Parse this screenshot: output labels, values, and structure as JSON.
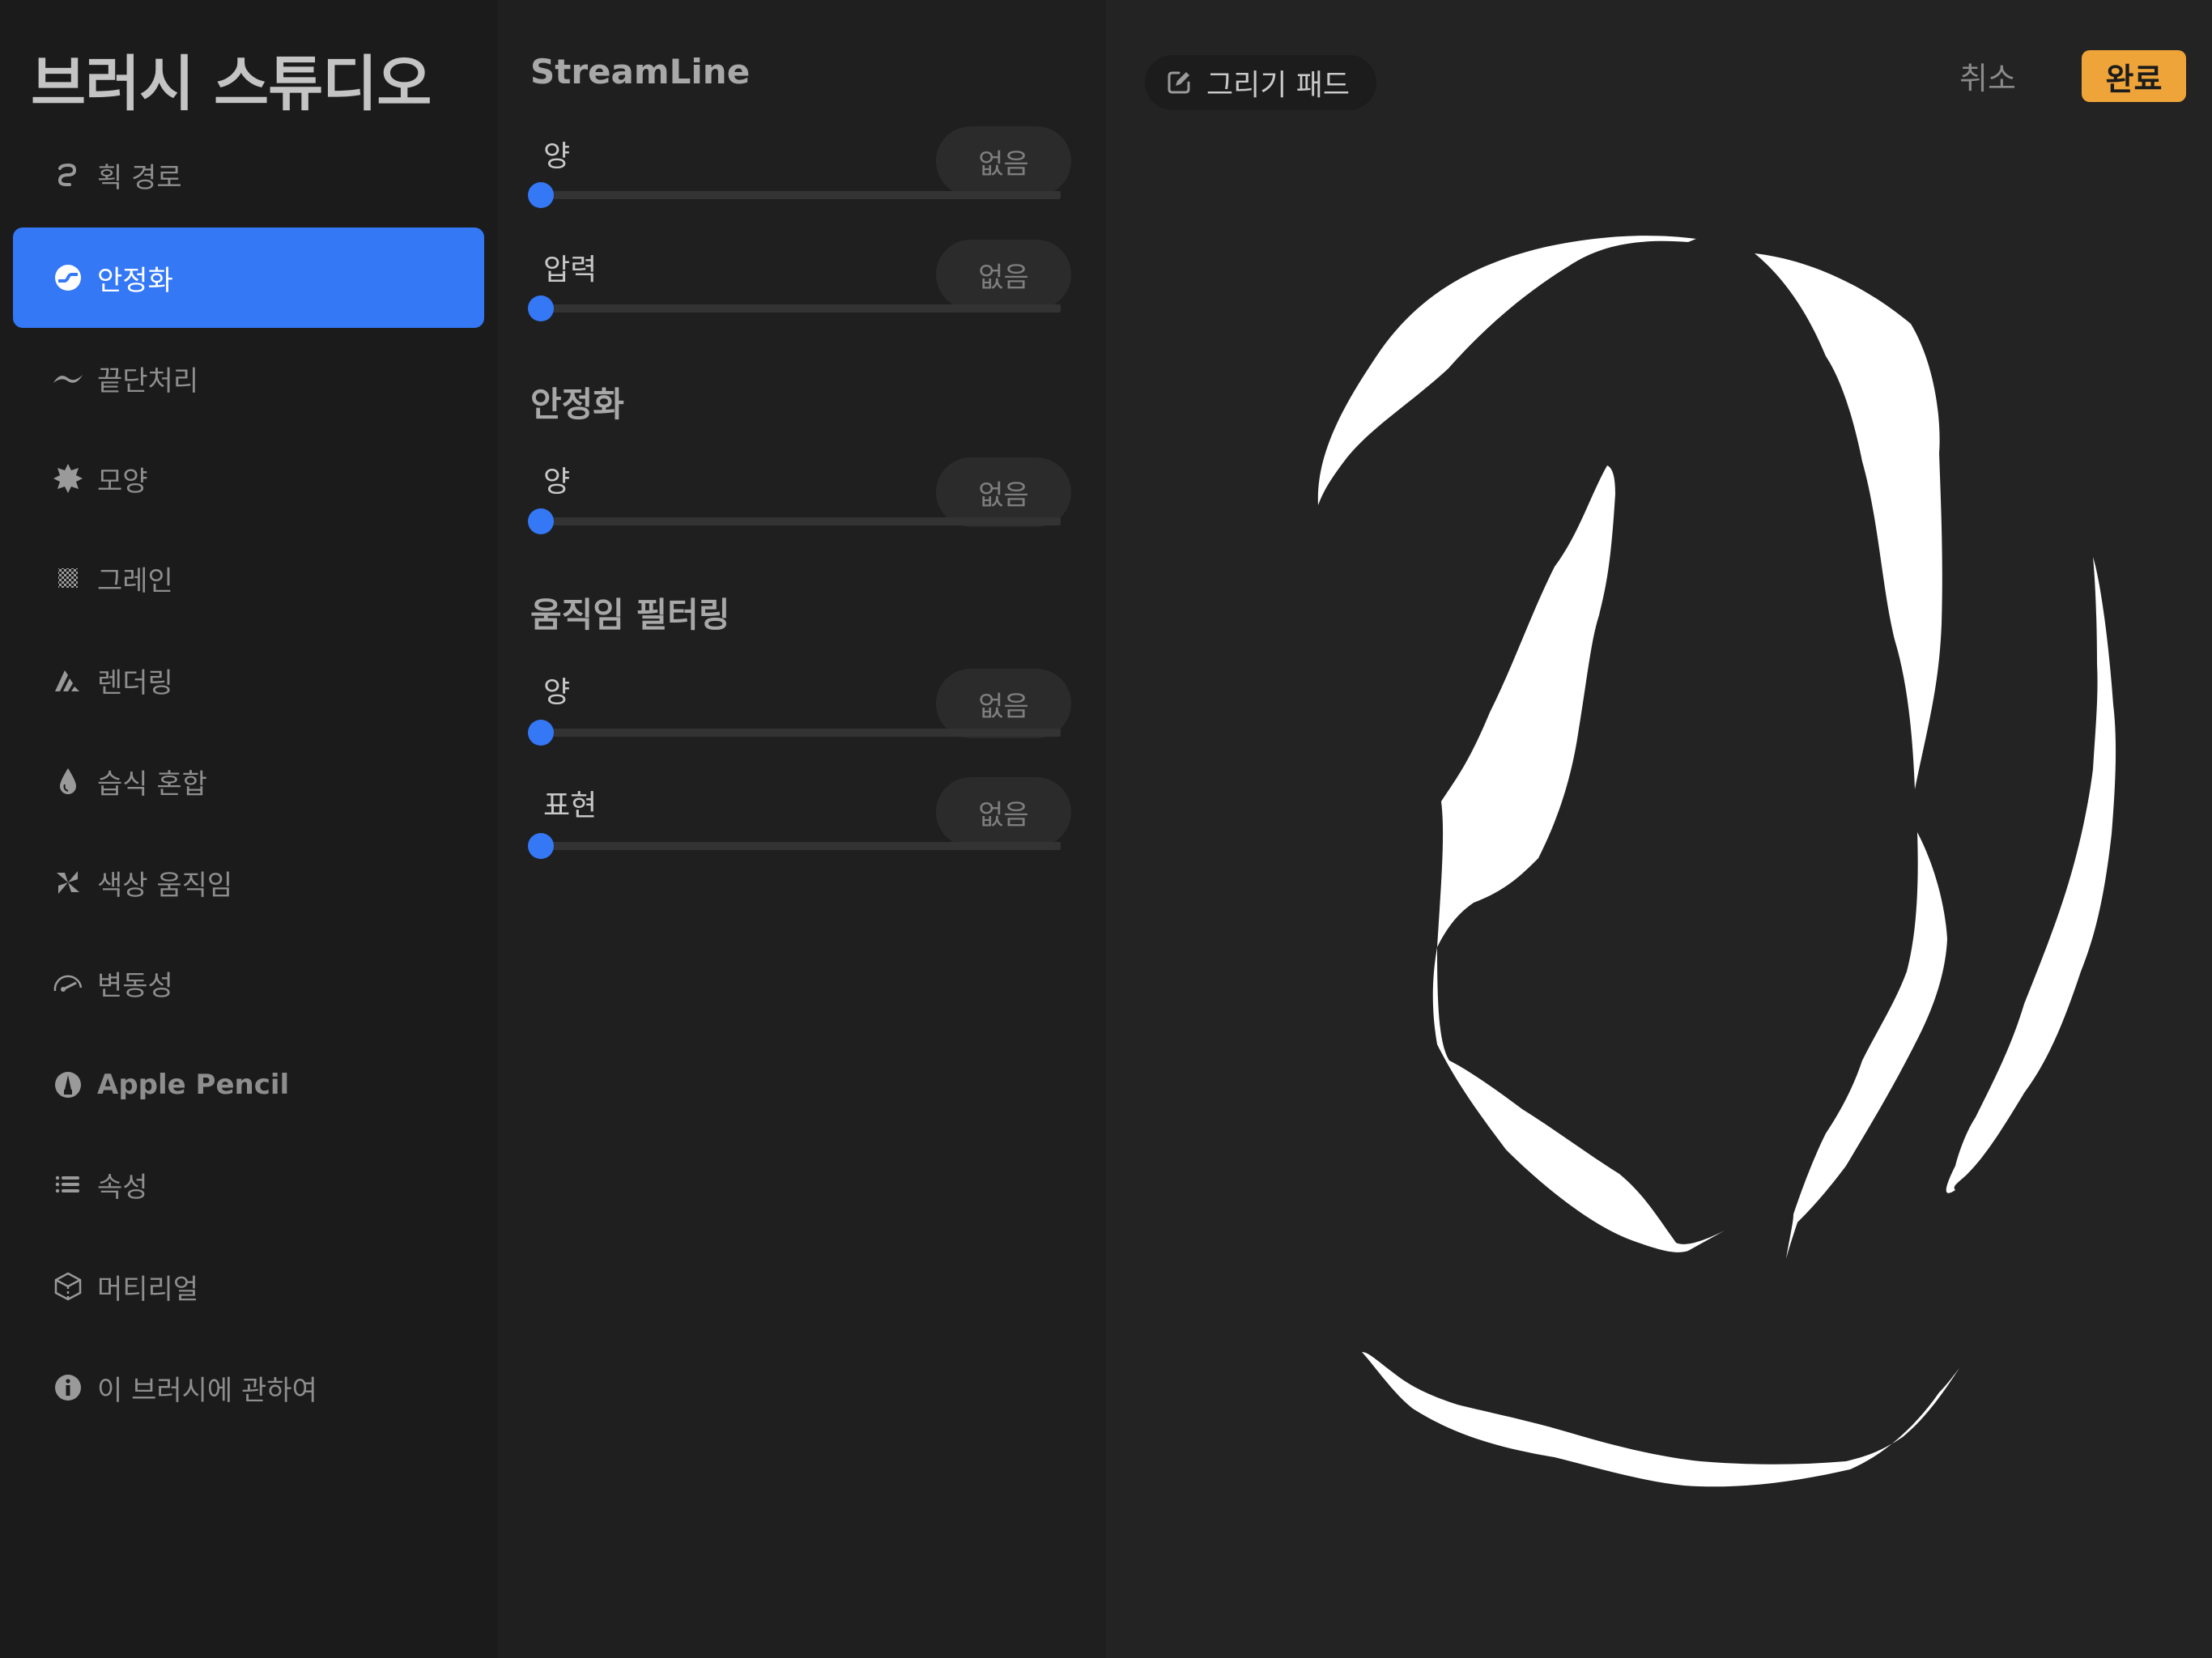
{
  "sidebar": {
    "title": "브러시 스튜디오",
    "items": [
      {
        "label": "획 경로",
        "icon": "stroke-path-icon",
        "active": false
      },
      {
        "label": "안정화",
        "icon": "stabilization-icon",
        "active": true
      },
      {
        "label": "끝단처리",
        "icon": "taper-icon",
        "active": false
      },
      {
        "label": "모양",
        "icon": "shape-icon",
        "active": false
      },
      {
        "label": "그레인",
        "icon": "grain-icon",
        "active": false
      },
      {
        "label": "렌더링",
        "icon": "rendering-icon",
        "active": false
      },
      {
        "label": "습식 혼합",
        "icon": "wet-mix-icon",
        "active": false
      },
      {
        "label": "색상 움직임",
        "icon": "color-dynamics-icon",
        "active": false
      },
      {
        "label": "변동성",
        "icon": "dynamics-gauge-icon",
        "active": false
      },
      {
        "label": "Apple Pencil",
        "icon": "apple-pencil-icon",
        "active": false
      },
      {
        "label": "속성",
        "icon": "properties-list-icon",
        "active": false
      },
      {
        "label": "머티리얼",
        "icon": "materials-cube-icon",
        "active": false
      },
      {
        "label": "이 브러시에 관하여",
        "icon": "info-icon",
        "active": false
      }
    ]
  },
  "settings": {
    "sections": [
      {
        "title": "StreamLine",
        "rows": [
          {
            "label": "양",
            "value": "없음",
            "slider_fraction": 0
          },
          {
            "label": "압력",
            "value": "없음",
            "slider_fraction": 0
          }
        ]
      },
      {
        "title": "안정화",
        "rows": [
          {
            "label": "양",
            "value": "없음",
            "slider_fraction": 0
          }
        ]
      },
      {
        "title": "움직임 필터링",
        "rows": [
          {
            "label": "양",
            "value": "없음",
            "slider_fraction": 0
          },
          {
            "label": "표현",
            "value": "없음",
            "slider_fraction": 0
          }
        ]
      }
    ]
  },
  "drawing_pad": {
    "pad_button_label": "그리기 패드",
    "cancel_label": "취소",
    "done_label": "완료"
  },
  "colors": {
    "accent": "#3478f6",
    "done": "#efa43a",
    "stroke": "#ffffff"
  }
}
